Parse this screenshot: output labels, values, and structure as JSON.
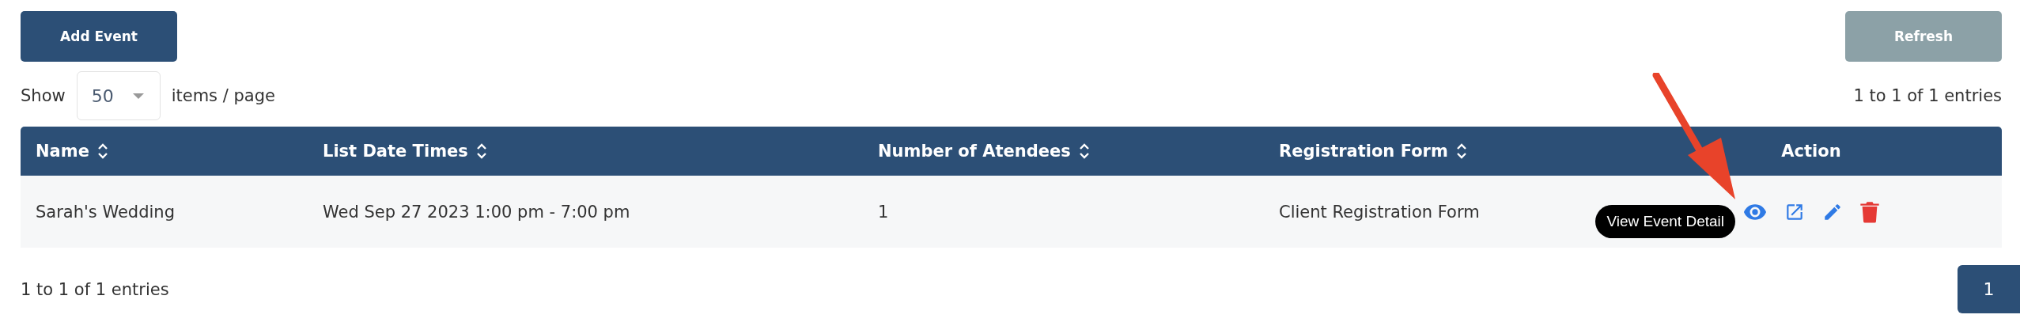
{
  "toolbar": {
    "buttons": [
      {
        "label": "Add Event",
        "disabled": false
      },
      {
        "label": "Refresh",
        "disabled": true
      }
    ]
  },
  "page_size": {
    "label": "Show",
    "value": "50",
    "suffix": "items / page"
  },
  "entries_top": "1 to 1 of 1 entries",
  "table": {
    "columns": [
      {
        "label": "Name",
        "sortable": true
      },
      {
        "label": "List Date Times",
        "sortable": true
      },
      {
        "label": "Number of Atendees",
        "sortable": true
      },
      {
        "label": "Registration Form",
        "sortable": true
      },
      {
        "label": "Action",
        "sortable": false
      }
    ],
    "rows": [
      {
        "cells": [
          "Sarah's Wedding",
          "Wed Sep 27 2023 1:00 pm - 7:00 pm",
          "1",
          "Client Registration Form"
        ],
        "actions": [
          {
            "kind": "view",
            "tooltip": "View Event Detail"
          },
          {
            "kind": "open"
          },
          {
            "kind": "edit"
          },
          {
            "kind": "delete"
          }
        ]
      }
    ]
  },
  "entries_bottom": "1 to 1 of 1 entries",
  "pagination": [
    {
      "label": "1",
      "selected": true
    }
  ]
}
